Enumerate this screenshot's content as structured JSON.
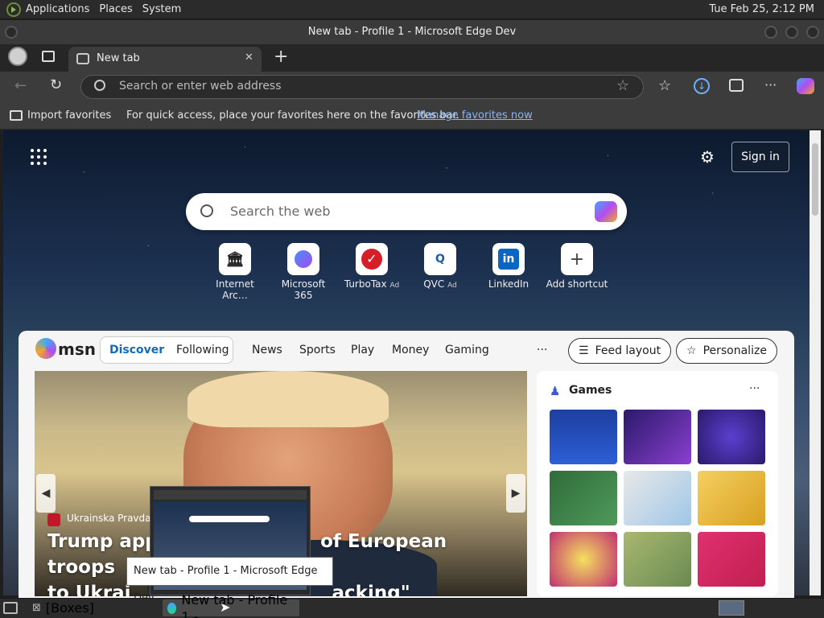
{
  "gnome": {
    "menus": [
      "Applications",
      "Places",
      "System"
    ],
    "clock": "Tue Feb 25,  2:12 PM"
  },
  "window": {
    "title": "New tab - Profile 1 - Microsoft Edge Dev"
  },
  "tabs": {
    "active_label": "New tab",
    "close_glyph": "✕",
    "new_tab_glyph": "+"
  },
  "addressbar": {
    "placeholder": "Search or enter web address"
  },
  "favorites_bar": {
    "import_label": "Import favorites",
    "hint_text": "For quick access, place your favorites here on the favorites bar.",
    "manage_link": "Manage favorites now"
  },
  "ntp": {
    "sign_in": "Sign in",
    "search_placeholder": "Search the web",
    "shortcuts": [
      {
        "label": "Internet Arc…",
        "ad": ""
      },
      {
        "label": "Microsoft 365",
        "ad": ""
      },
      {
        "label": "TurboTax",
        "ad": "Ad"
      },
      {
        "label": "QVC",
        "ad": "Ad"
      },
      {
        "label": "LinkedIn",
        "ad": ""
      },
      {
        "label": "Add shortcut",
        "ad": ""
      }
    ]
  },
  "msn": {
    "logo": "msn",
    "tabs": [
      "Discover",
      "Following"
    ],
    "nav": [
      "News",
      "Sports",
      "Play",
      "Money",
      "Gaming"
    ],
    "more": "···",
    "feed_layout": "Feed layout",
    "personalize": "Personalize"
  },
  "hero": {
    "source": "Ukrainska Pravda",
    "title_line1": "Trump appr",
    "title_line1b": "of European troops",
    "title_line2": "to Ukrai",
    "title_line2b": "acking\""
  },
  "games": {
    "title": "Games",
    "more": "···"
  },
  "tooltip": {
    "text": "New tab - Profile 1 - Microsoft Edge Dev"
  },
  "taskbar": {
    "boxes": "[Boxes]",
    "edge_task": "New tab - Profile 1 -..."
  },
  "colors": {
    "accent": "#0f6cbd",
    "link": "#8ab4f8",
    "bg_dark": "#3c3c3c"
  }
}
